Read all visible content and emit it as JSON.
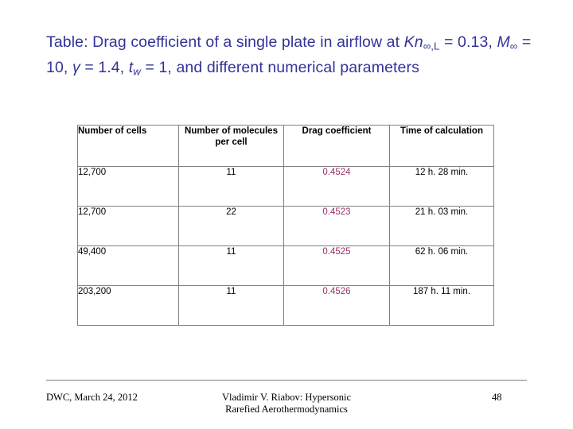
{
  "slide": {
    "title": {
      "line1_a": "Table:  Drag coefficient of a single plate in airflow at ",
      "kn_symbol": "Kn",
      "kn_sub": "∞,L",
      "after_kn": " = 0.13,  ",
      "m_symbol": "M",
      "m_sub": "∞",
      "after_m": " = 10, ",
      "gamma_symbol": "γ",
      "after_gamma": " = 1.4,  ",
      "tw_symbol": "t",
      "tw_sub": "w",
      "after_tw": " = 1, and different numerical parameters"
    },
    "table": {
      "headers": [
        "Number of cells",
        "Number of molecules per cell",
        "Drag coefficient",
        "Time of calculation"
      ],
      "rows": [
        {
          "cells": "12,700",
          "molecules": "11",
          "drag": "0.4524",
          "time": "12 h. 28 min."
        },
        {
          "cells": "12,700",
          "molecules": "22",
          "drag": "0.4523",
          "time": "21 h. 03 min."
        },
        {
          "cells": "49,400",
          "molecules": "11",
          "drag": "0.4525",
          "time": "62 h. 06 min."
        },
        {
          "cells": "203,200",
          "molecules": "11",
          "drag": "0.4526",
          "time": "187 h. 11 min."
        }
      ]
    },
    "footer": {
      "left": "DWC, March 24, 2012",
      "center_line1": "Vladimir V. Riabov: Hypersonic",
      "center_line2": "Rarefied Aerothermodynamics",
      "page_number": "48"
    },
    "colors": {
      "title": "#333399",
      "drag_value": "#993366",
      "border": "#808080"
    }
  }
}
